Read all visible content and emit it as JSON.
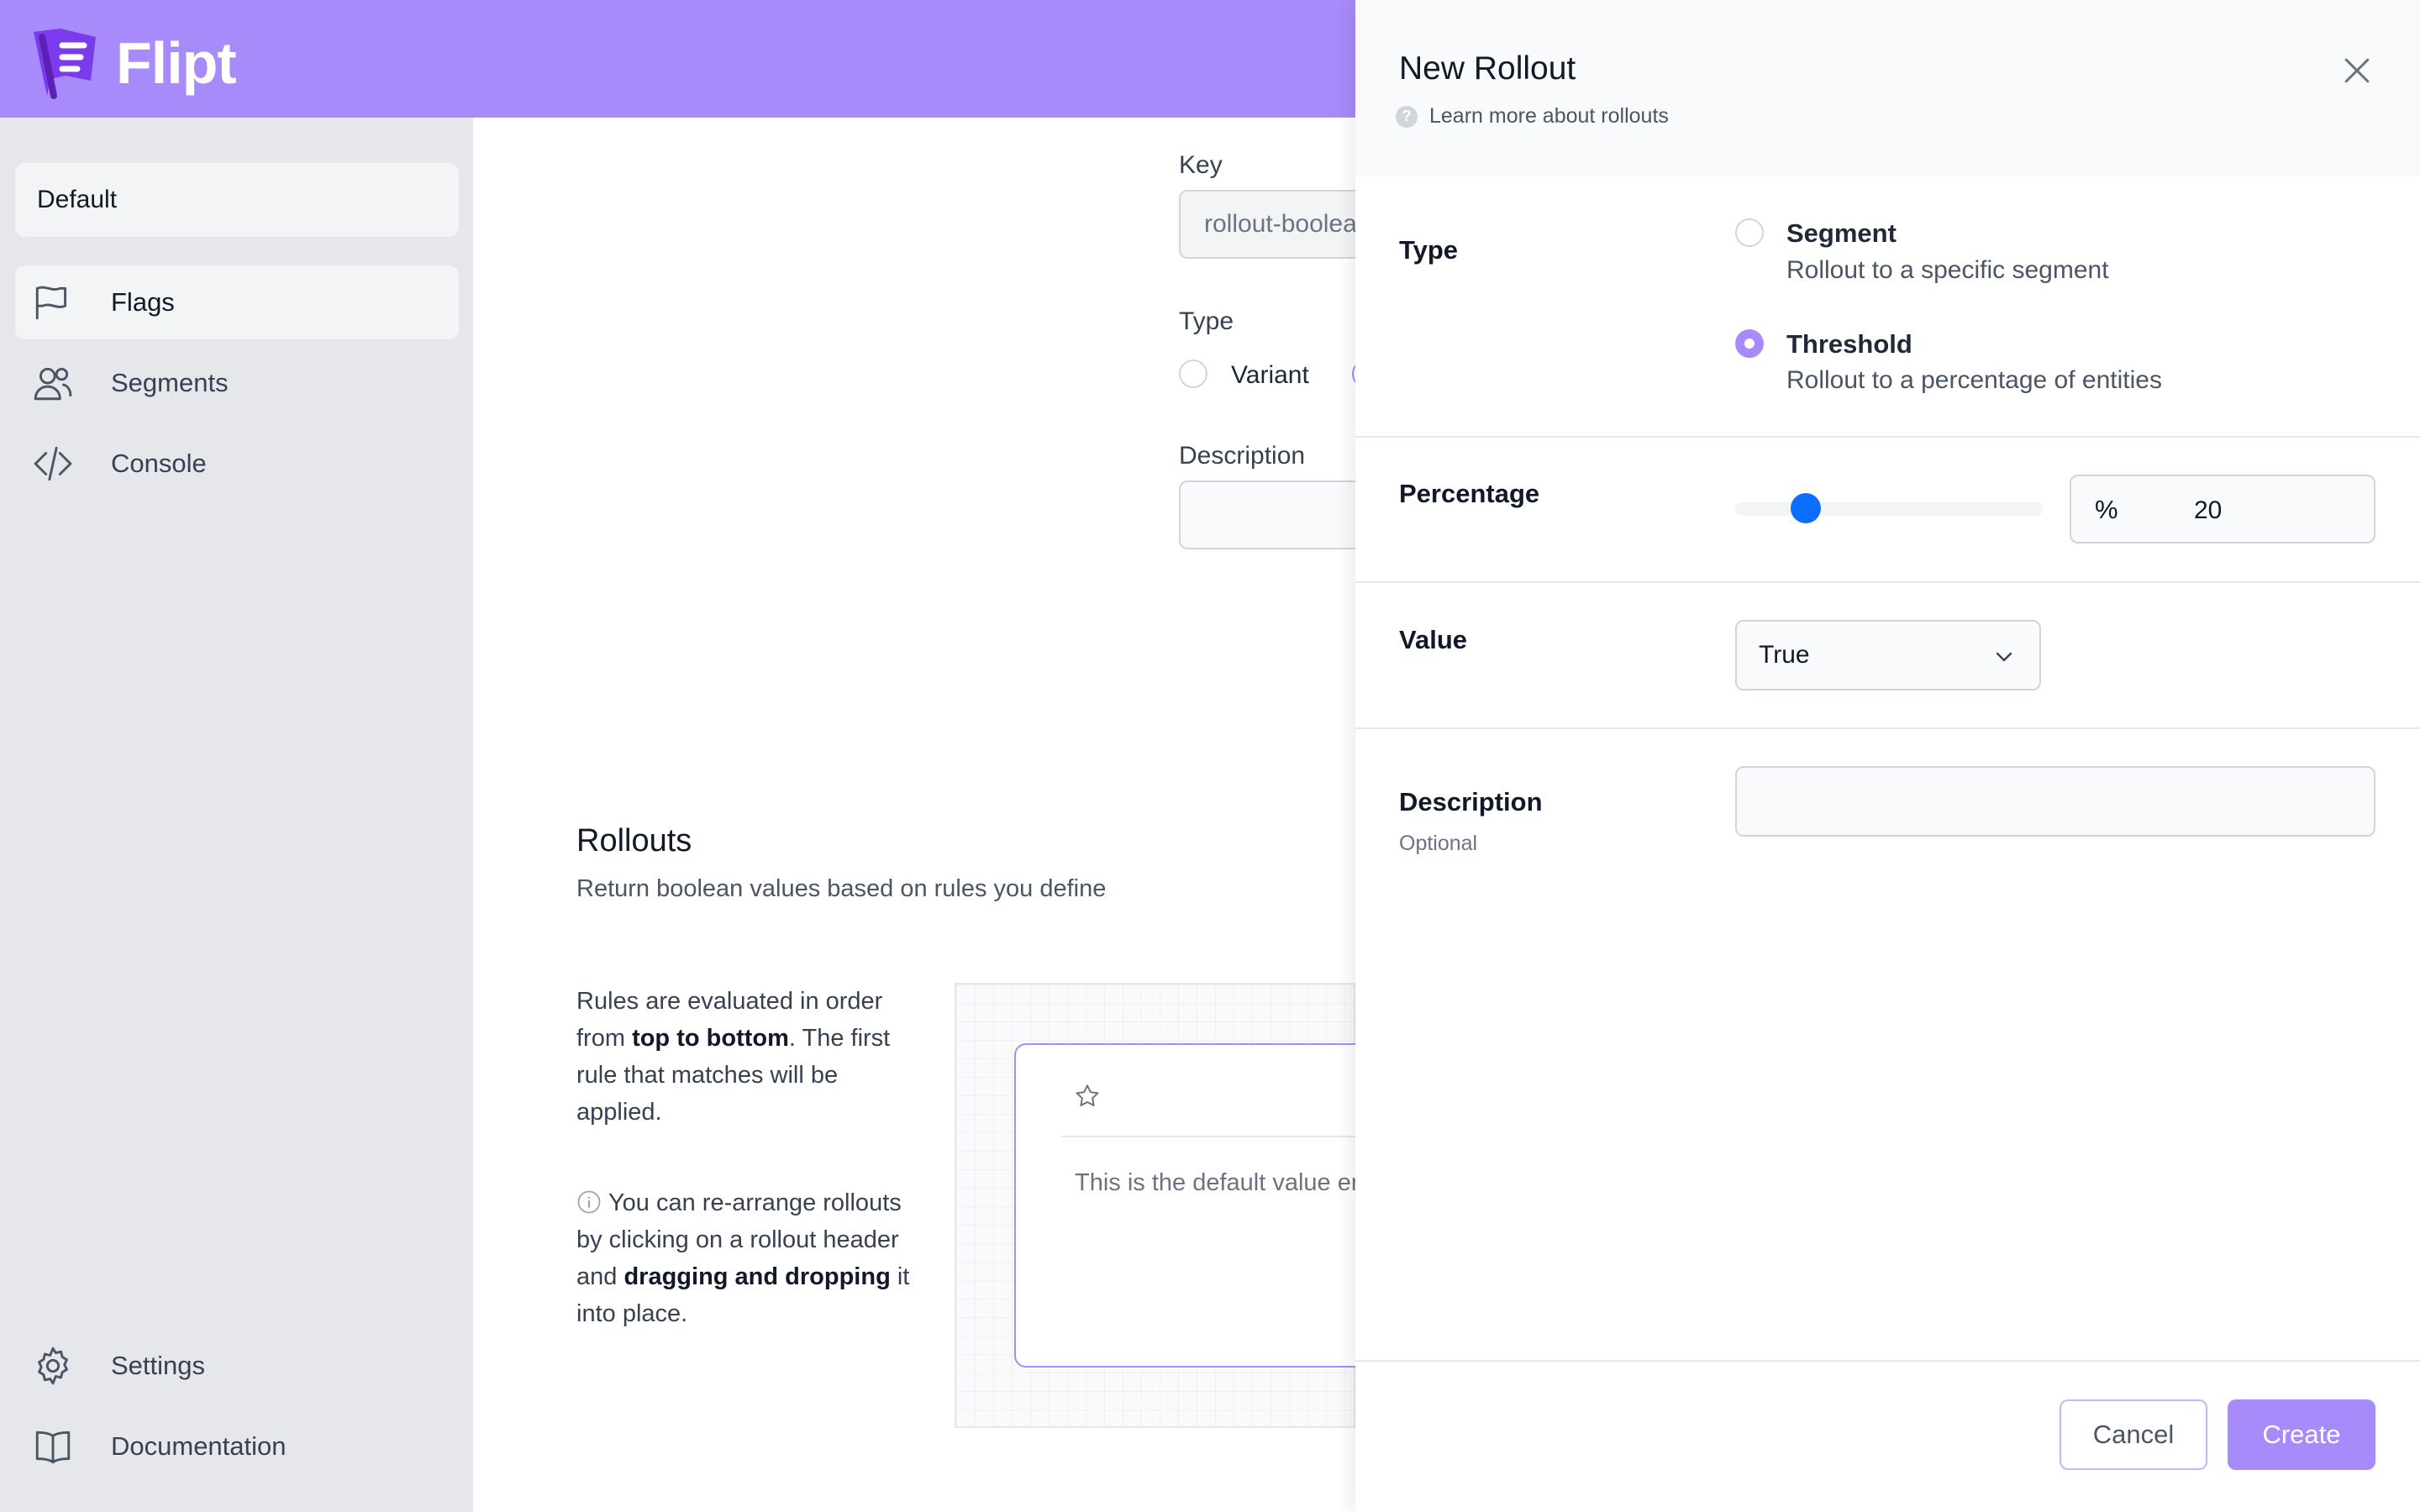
{
  "app": {
    "name": "Flipt",
    "brand_color": "#a78bfa"
  },
  "sidebar": {
    "namespace": "Default",
    "items": [
      {
        "label": "Flags",
        "icon": "flag-icon"
      },
      {
        "label": "Segments",
        "icon": "users-icon"
      },
      {
        "label": "Console",
        "icon": "code-icon"
      }
    ],
    "bottom_items": [
      {
        "label": "Settings",
        "icon": "gear-icon"
      },
      {
        "label": "Documentation",
        "icon": "book-icon"
      }
    ]
  },
  "main": {
    "key_label": "Key",
    "key_value": "rollout-boolean",
    "type_label": "Type",
    "type_option_variant": "Variant",
    "description_label": "Description",
    "rollouts_title": "Rollouts",
    "rollouts_subtitle": "Return boolean values based on rules you define",
    "rules_text_1": "Rules are evaluated in order from ",
    "rules_text_bold": "top to bottom",
    "rules_text_2": ". The first rule that matches will be applied.",
    "rearrange_text_1": "You can re-arrange rollouts by clicking on a rollout header and ",
    "rearrange_text_bold": "dragging and dropping",
    "rearrange_text_2": " it into place.",
    "default_card_text": "This is the default value enabled state."
  },
  "panel": {
    "title": "New Rollout",
    "help_link": "Learn more about rollouts",
    "type_label": "Type",
    "options": [
      {
        "title": "Segment",
        "description": "Rollout to a specific segment",
        "selected": false
      },
      {
        "title": "Threshold",
        "description": "Rollout to a percentage of entities",
        "selected": true
      }
    ],
    "percentage_label": "Percentage",
    "percentage_symbol": "%",
    "percentage_value": "20",
    "value_label": "Value",
    "value_selected": "True",
    "description_label": "Description",
    "description_optional": "Optional",
    "cancel_label": "Cancel",
    "create_label": "Create"
  }
}
